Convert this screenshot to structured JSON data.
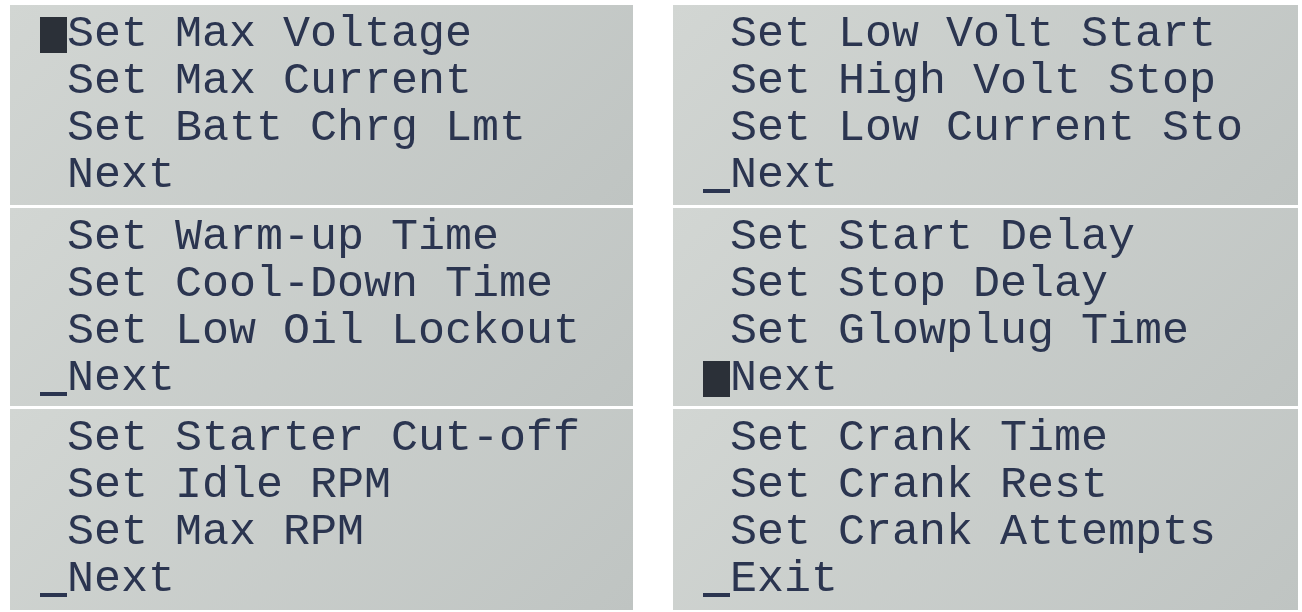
{
  "screens": [
    {
      "kind": "block",
      "lines": [
        {
          "text": "Set Max Voltage",
          "selected": true
        },
        {
          "text": "Set Max Current",
          "selected": false
        },
        {
          "text": "Set Batt Chrg Lmt",
          "selected": false
        },
        {
          "text": "Next",
          "selected": false
        }
      ]
    },
    {
      "kind": "underline",
      "lines": [
        {
          "text": "Set Low Volt Start",
          "selected": false
        },
        {
          "text": "Set High Volt Stop",
          "selected": false
        },
        {
          "text": "Set Low Current Sto",
          "selected": false
        },
        {
          "text": "Next",
          "selected": true
        }
      ]
    },
    {
      "kind": "underline",
      "lines": [
        {
          "text": "Set Warm-up Time",
          "selected": false
        },
        {
          "text": "Set Cool-Down Time",
          "selected": false
        },
        {
          "text": "Set Low Oil Lockout",
          "selected": false
        },
        {
          "text": "Next",
          "selected": true
        }
      ]
    },
    {
      "kind": "block",
      "lines": [
        {
          "text": "Set Start Delay",
          "selected": false
        },
        {
          "text": "Set Stop Delay",
          "selected": false
        },
        {
          "text": "Set Glowplug Time",
          "selected": false
        },
        {
          "text": "Next",
          "selected": true
        }
      ]
    },
    {
      "kind": "underline",
      "lines": [
        {
          "text": "Set Starter Cut-off",
          "selected": false
        },
        {
          "text": "Set Idle RPM",
          "selected": false
        },
        {
          "text": "Set Max RPM",
          "selected": false
        },
        {
          "text": "Next",
          "selected": true
        }
      ]
    },
    {
      "kind": "underline",
      "lines": [
        {
          "text": "Set Crank Time",
          "selected": false
        },
        {
          "text": "Set Crank Rest",
          "selected": false
        },
        {
          "text": "Set Crank Attempts",
          "selected": false
        },
        {
          "text": "Exit",
          "selected": true
        }
      ]
    }
  ]
}
